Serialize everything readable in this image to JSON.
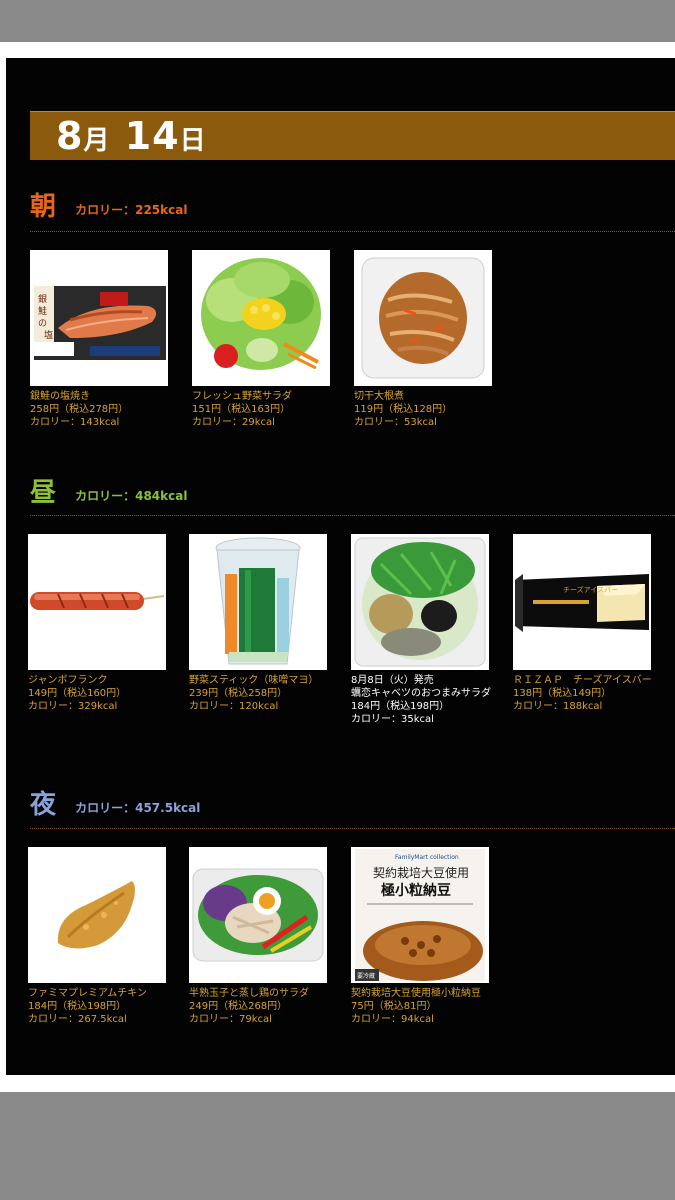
{
  "date": {
    "month": "8",
    "month_unit": "月",
    "day": "14",
    "day_unit": "日"
  },
  "sections": [
    {
      "kanji": "朝",
      "calories": "カロリー：225kcal",
      "color": "#e8661a",
      "items": [
        {
          "name": "銀鮭の塩焼き",
          "price": "258円（税込278円）",
          "kcal": "カロリー：143kcal",
          "image": "grilled-salmon"
        },
        {
          "name": "フレッシュ野菜サラダ",
          "price": "151円（税込163円）",
          "kcal": "カロリー：29kcal",
          "image": "vegetable-salad"
        },
        {
          "name": "切干大根煮",
          "price": "119円（税込128円）",
          "kcal": "カロリー：53kcal",
          "image": "dried-radish"
        }
      ]
    },
    {
      "kanji": "昼",
      "calories": "カロリー：484kcal",
      "color": "#8dbf3a",
      "items": [
        {
          "name": "ジャンボフランク",
          "price": "149円（税込160円）",
          "kcal": "カロリー：329kcal",
          "image": "sausage"
        },
        {
          "name": "野菜スティック（味噌マヨ）",
          "price": "239円（税込258円）",
          "kcal": "カロリー：120kcal",
          "image": "vegetable-sticks"
        },
        {
          "note": "8月8日（火）発売",
          "name": "蠣恋キャベツのおつまみサラダ",
          "price": "184円（税込198円）",
          "kcal": "カロリー：35kcal",
          "image": "cabbage-salad"
        },
        {
          "name": "ＲＩＺＡＰ　チーズアイスバー",
          "price": "138円（税込149円）",
          "kcal": "カロリー：188kcal",
          "image": "cheese-ice-bar"
        }
      ]
    },
    {
      "kanji": "夜",
      "calories": "カロリー：457.5kcal",
      "color": "#8aa3d8",
      "items": [
        {
          "name": "ファミマプレミアムチキン",
          "price": "184円（税込198円）",
          "kcal": "カロリー：267.5kcal",
          "image": "fried-chicken"
        },
        {
          "name": "半熟玉子と蒸し鶏のサラダ",
          "price": "249円（税込268円）",
          "kcal": "カロリー：79kcal",
          "image": "egg-chicken-salad"
        },
        {
          "name": "契約栽培大豆使用極小粒納豆",
          "price": "75円（税込81円）",
          "kcal": "カロリー：94kcal",
          "image": "natto"
        }
      ]
    }
  ],
  "natto_pack": {
    "brand": "FamilyMart collection",
    "line1": "契約栽培大豆使用",
    "line2": "極小粒納豆",
    "tag": "要冷蔵"
  },
  "ice_bar_pack": {
    "label": "チーズアイスバー"
  },
  "salmon_pack": {
    "label": "銀鮭の塩焼き"
  },
  "price_text_color": "#d9a332"
}
